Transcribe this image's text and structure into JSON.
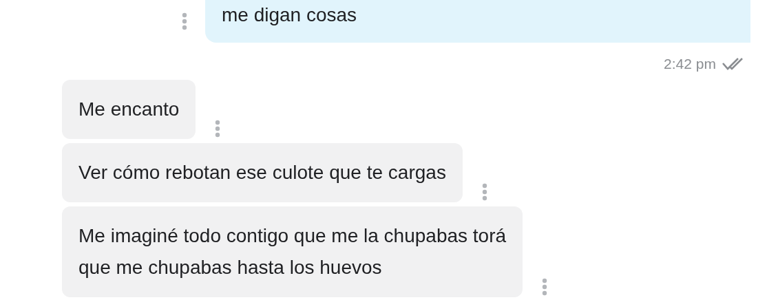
{
  "messages": [
    {
      "kind": "outgoing",
      "lines": [
        "me digan cosas"
      ]
    },
    {
      "kind": "timestamp",
      "time": "2:42 pm",
      "read": true
    },
    {
      "kind": "incoming",
      "lines": [
        "Me encanto"
      ]
    },
    {
      "kind": "incoming",
      "lines": [
        "Ver cómo rebotan ese culote que te cargas"
      ]
    },
    {
      "kind": "incoming",
      "lines": [
        "Me imaginé todo contigo que me la chupabas torá",
        "que me chupabas hasta los huevos"
      ]
    }
  ]
}
